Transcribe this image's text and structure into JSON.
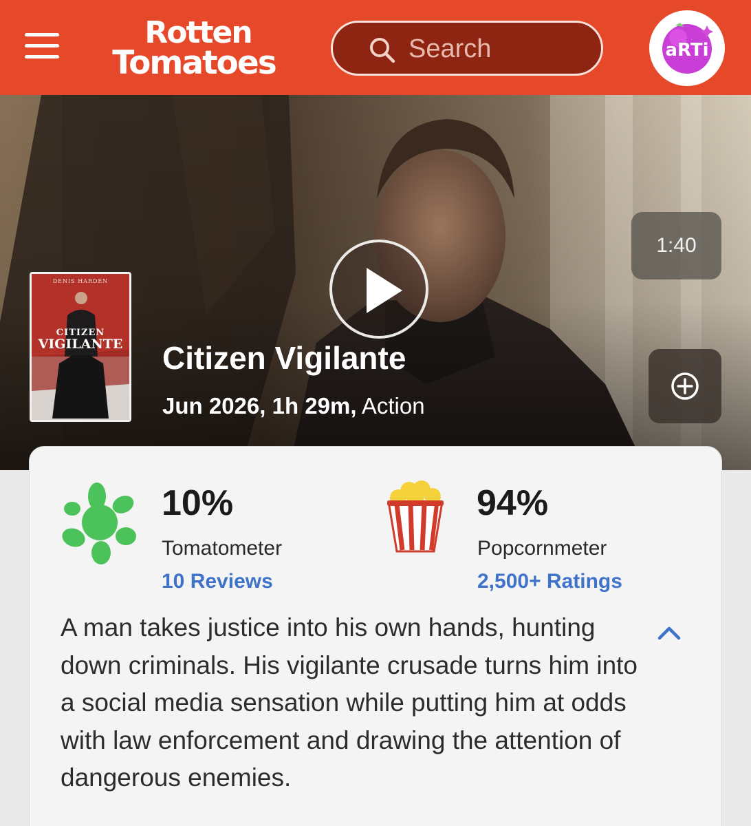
{
  "header": {
    "logo_line1": "Rotten",
    "logo_line2": "Tomatoes",
    "search_placeholder": "Search",
    "avatar_label": "aRTi"
  },
  "hero": {
    "video_duration": "1:40",
    "poster": {
      "top_text": "DENIS HARDEN",
      "title_line1": "CITIZEN",
      "title_line2": "VIGILANTE"
    },
    "title": "Citizen Vigilante",
    "release_runtime": "Jun 2026, 1h 29m,",
    "genre": "Action"
  },
  "scores": {
    "tomatometer": {
      "value": "10%",
      "label": "Tomatometer",
      "count": "10 Reviews",
      "icon": "rotten-splat-icon"
    },
    "popcornmeter": {
      "value": "94%",
      "label": "Popcornmeter",
      "count": "2,500+ Ratings",
      "icon": "full-popcorn-bucket-icon"
    }
  },
  "synopsis": "A man takes justice into his own hands, hunting down criminals. His vigilante crusade turns him into a social media sensation while putting him at odds with law enforcement and drawing the attention of dangerous enemies.",
  "colors": {
    "brand_red": "#e6482a",
    "rotten_green": "#4cc25a",
    "link_blue": "#3f73c9"
  }
}
